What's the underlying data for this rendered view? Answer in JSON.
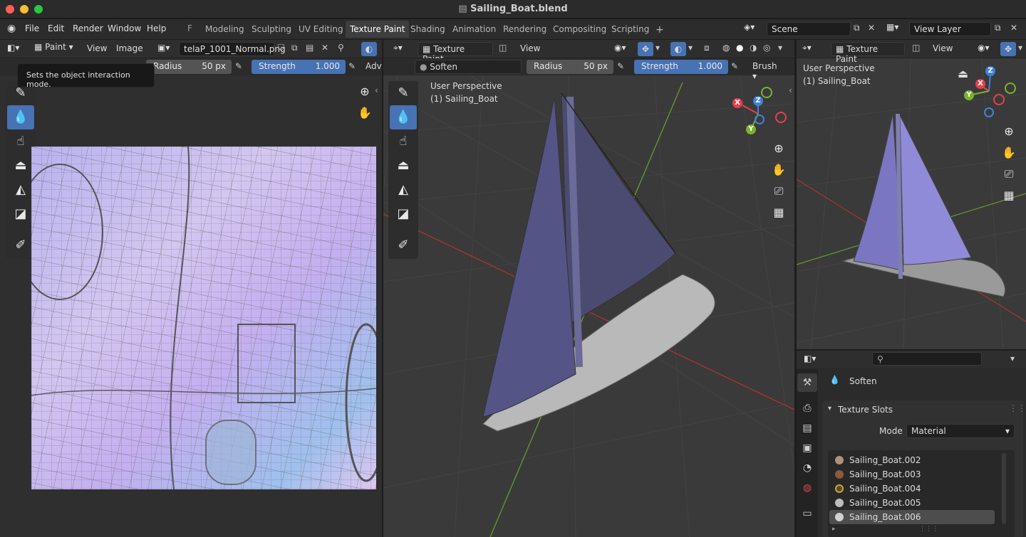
{
  "window": {
    "title": "Sailing_Boat.blend"
  },
  "menubar": {
    "menus": [
      "File",
      "Edit",
      "Render",
      "Window",
      "Help"
    ],
    "extra_label": "F",
    "workspaces": [
      "Modeling",
      "Sculpting",
      "UV Editing",
      "Texture Paint",
      "Shading",
      "Animation",
      "Rendering",
      "Compositing",
      "Scripting"
    ],
    "add_tab": "+",
    "scene": "Scene",
    "view_layer": "View Layer"
  },
  "image_editor": {
    "mode": "Paint",
    "view": "View",
    "image_menu": "Image",
    "image_name": "telaP_1001_Normal.png",
    "tooltip": "Sets the object interaction mode.",
    "radius_label": "Radius",
    "radius_value": "50 px",
    "strength_label": "Strength",
    "strength_value": "1.000",
    "advanced": "Adv"
  },
  "viewport_main": {
    "mode": "Texture Paint",
    "view": "View",
    "brush_name": "Soften",
    "radius_label": "Radius",
    "radius_value": "50 px",
    "strength_label": "Strength",
    "strength_value": "1.000",
    "brush_menu": "Brush",
    "overlay_title": "User Perspective",
    "overlay_object": "(1) Sailing_Boat"
  },
  "viewport_small": {
    "mode": "Texture Paint",
    "view": "View",
    "overlay_title": "User Perspective",
    "overlay_object": "(1) Sailing_Boat"
  },
  "gizmo": {
    "x": "X",
    "y": "Y",
    "z": "Z"
  },
  "properties": {
    "search_placeholder": "",
    "brush_name": "Soften",
    "panel_title": "Texture Slots",
    "mode_label": "Mode",
    "mode_value": "Material",
    "slots": [
      "Sailing_Boat.002",
      "Sailing_Boat.003",
      "Sailing_Boat.004",
      "Sailing_Boat.005",
      "Sailing_Boat.006"
    ],
    "selected_slot": 4
  },
  "colors": {
    "accent": "#4772b3",
    "axis_x": "#e5414b",
    "axis_y": "#7ab32f",
    "axis_z": "#3f82d9",
    "close": "#ff5f57",
    "minimize": "#febc2e",
    "maximize": "#28c840"
  }
}
